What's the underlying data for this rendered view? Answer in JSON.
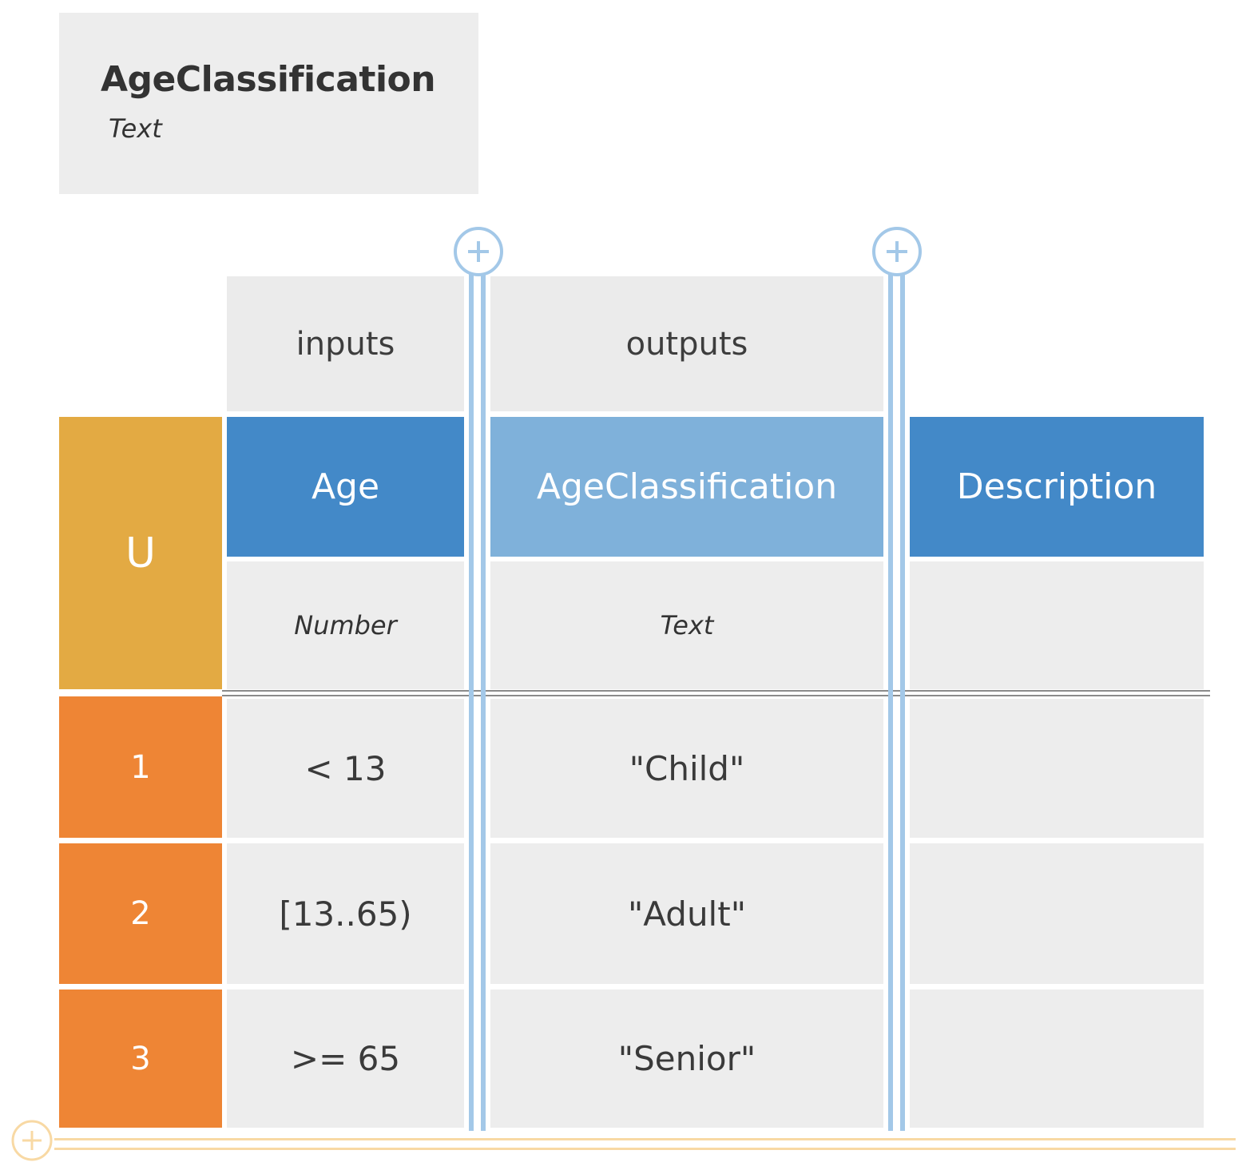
{
  "decision": {
    "name": "AgeClassification",
    "type": "Text"
  },
  "table": {
    "hit_policy": "U",
    "groups": {
      "inputs": "inputs",
      "outputs": "outputs"
    },
    "columns": [
      {
        "label": "Age",
        "type": "Number",
        "kind": "input"
      },
      {
        "label": "AgeClassification",
        "type": "Text",
        "kind": "output"
      },
      {
        "label": "Description",
        "type": "",
        "kind": "annotation"
      }
    ],
    "rules": [
      {
        "number": "1",
        "age": "< 13",
        "classification": "\"Child\"",
        "description": ""
      },
      {
        "number": "2",
        "age": "[13..65)",
        "classification": "\"Adult\"",
        "description": ""
      },
      {
        "number": "3",
        "age": ">= 65",
        "classification": "\"Senior\"",
        "description": ""
      }
    ]
  },
  "icons": {
    "add_input_column": "plus-circle-icon",
    "add_output_column": "plus-circle-icon",
    "add_rule": "plus-circle-icon"
  },
  "colors": {
    "input_header": "#4389c8",
    "output_header": "#7fb1da",
    "hit_policy": "#e3aa43",
    "rule_number": "#ee8535",
    "column_connector": "#a3c8e8",
    "rule_connector": "#f8d9a4"
  }
}
